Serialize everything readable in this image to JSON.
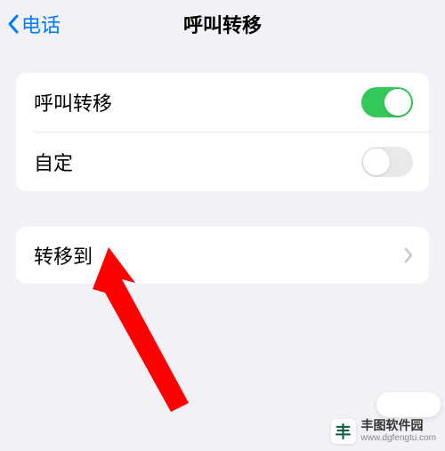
{
  "header": {
    "back_label": "电话",
    "title": "呼叫转移"
  },
  "section1": {
    "row1_label": "呼叫转移",
    "row1_toggle": true,
    "row2_label": "自定",
    "row2_toggle": false
  },
  "section2": {
    "row1_label": "转移到"
  },
  "watermark": {
    "title": "丰图软件园",
    "url": "www.dgfengtu.com",
    "logo_text": "丰"
  }
}
